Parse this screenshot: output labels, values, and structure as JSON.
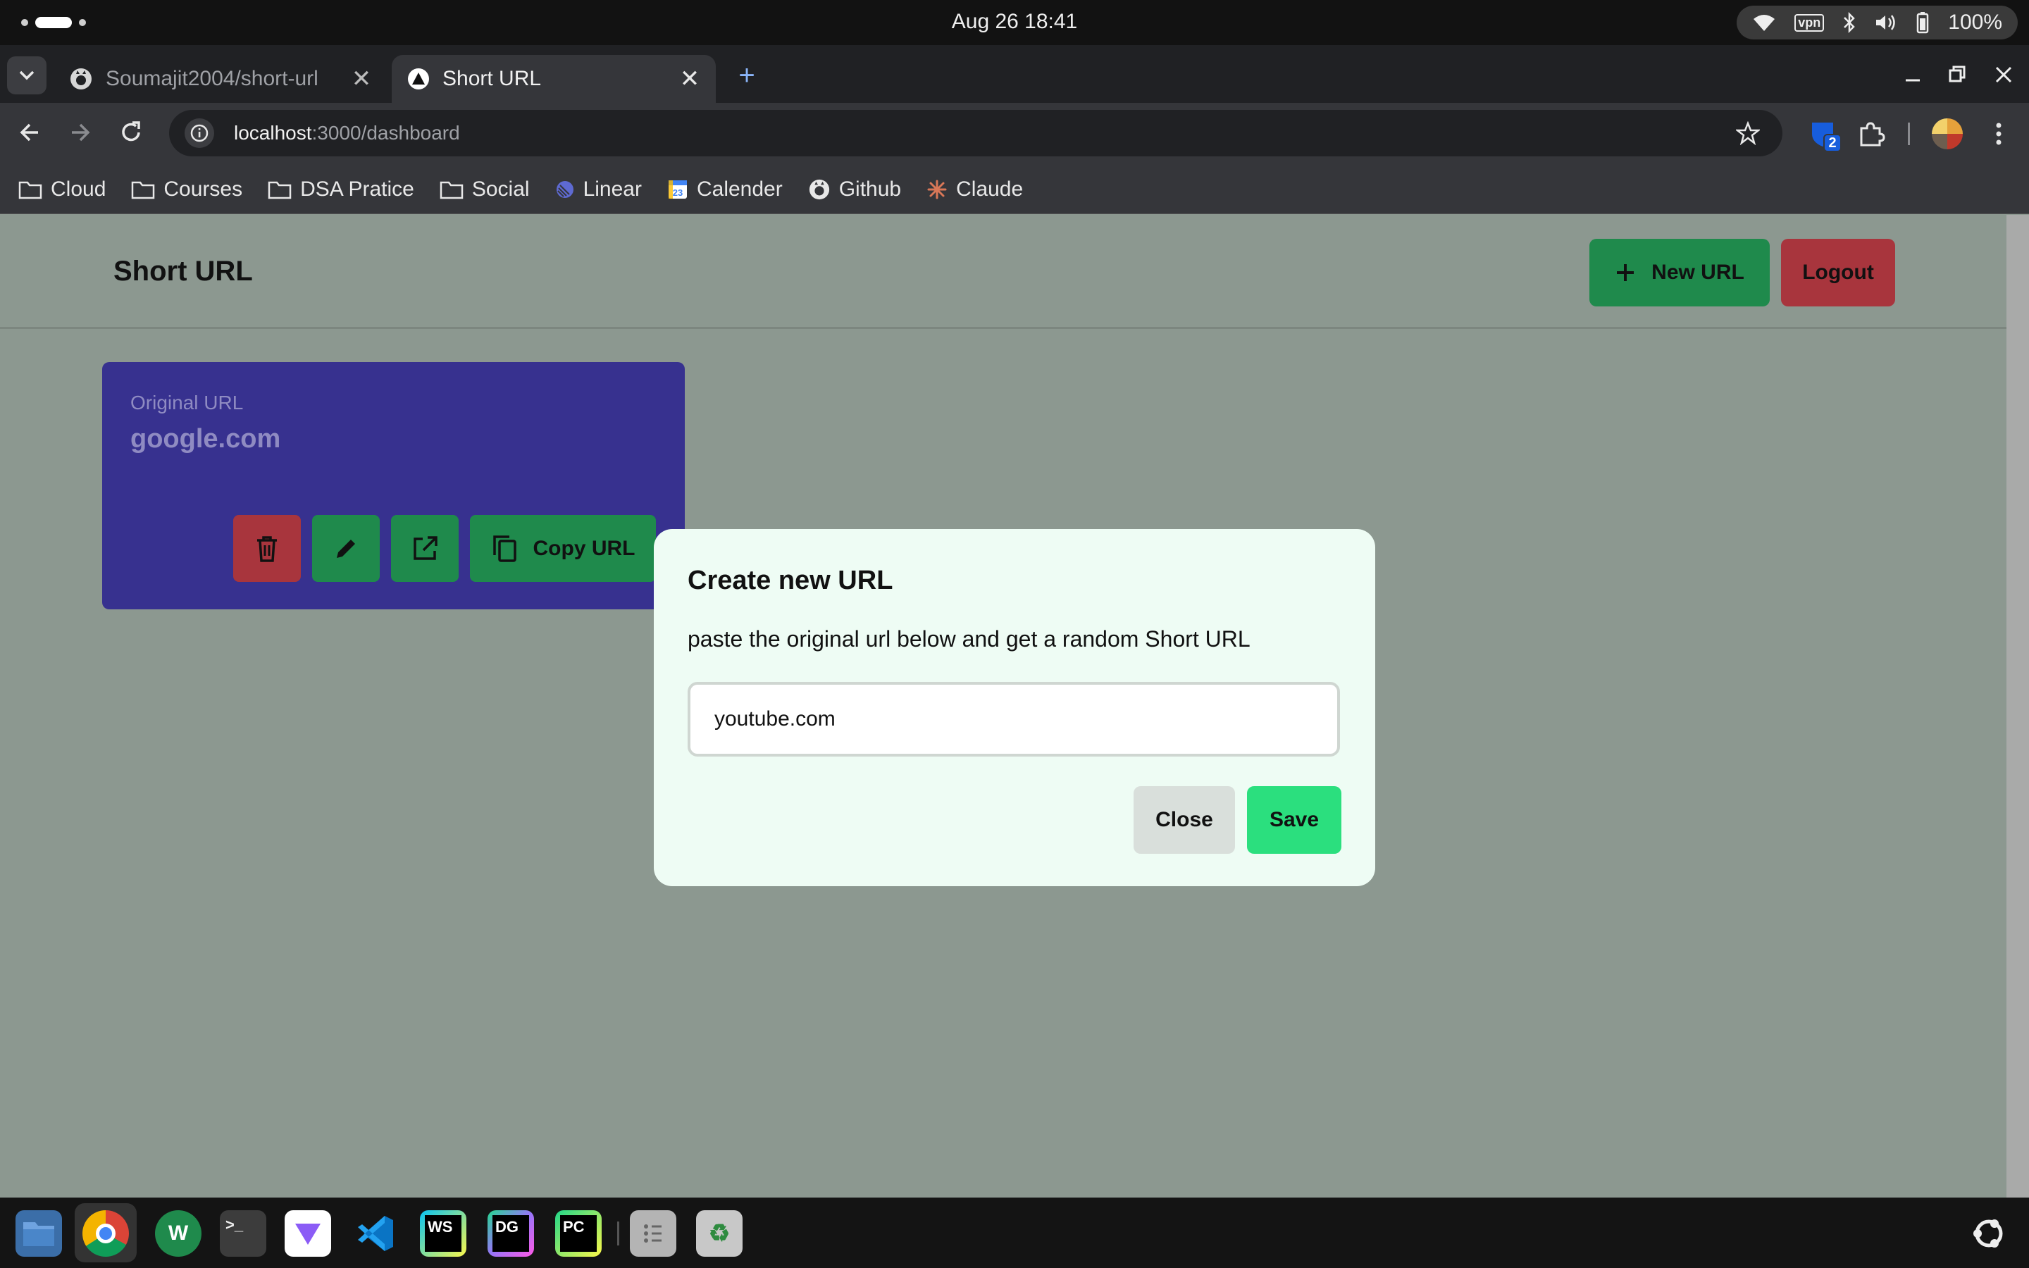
{
  "system": {
    "clock": "Aug 26  18:41",
    "battery": "100%",
    "vpn": "vpn"
  },
  "browser": {
    "tabs": [
      {
        "title": "Soumajit2004/short-url",
        "icon": "github-icon",
        "active": false
      },
      {
        "title": "Short URL",
        "icon": "app-logo-icon",
        "active": true
      }
    ],
    "address": {
      "host": "localhost",
      "path": ":3000/dashboard"
    },
    "extension_badge": "2",
    "bookmarks": [
      {
        "label": "Cloud",
        "icon": "folder-icon"
      },
      {
        "label": "Courses",
        "icon": "folder-icon"
      },
      {
        "label": "DSA Pratice",
        "icon": "folder-icon"
      },
      {
        "label": "Social",
        "icon": "folder-icon"
      },
      {
        "label": "Linear",
        "icon": "linear-icon"
      },
      {
        "label": "Calender",
        "icon": "calendar-icon"
      },
      {
        "label": "Github",
        "icon": "github-icon"
      },
      {
        "label": "Claude",
        "icon": "claude-icon"
      }
    ]
  },
  "app": {
    "title": "Short URL",
    "new_url_label": "New URL",
    "logout_label": "Logout",
    "card": {
      "label": "Original URL",
      "value": "google.com",
      "copy_label": "Copy URL"
    },
    "colors": {
      "green": "#1f8a4c",
      "red": "#a8353d",
      "card": "#37318f",
      "save": "#2bdf7e"
    }
  },
  "modal": {
    "title": "Create new URL",
    "description": "paste the original url below and get a random Short URL",
    "input_value": "youtube.com",
    "close_label": "Close",
    "save_label": "Save"
  },
  "taskbar": {
    "apps": [
      "files-icon",
      "chrome-icon",
      "whatsapp-icon",
      "terminal-icon",
      "proton-vpn-icon",
      "vscode-icon",
      "webstorm-icon",
      "datagrip-icon",
      "pycharm-icon",
      "apps-grid-icon",
      "trash-icon",
      "ubuntu-icon"
    ],
    "labels": {
      "ws": "WS",
      "dg": "DG",
      "pc": "PC"
    }
  }
}
